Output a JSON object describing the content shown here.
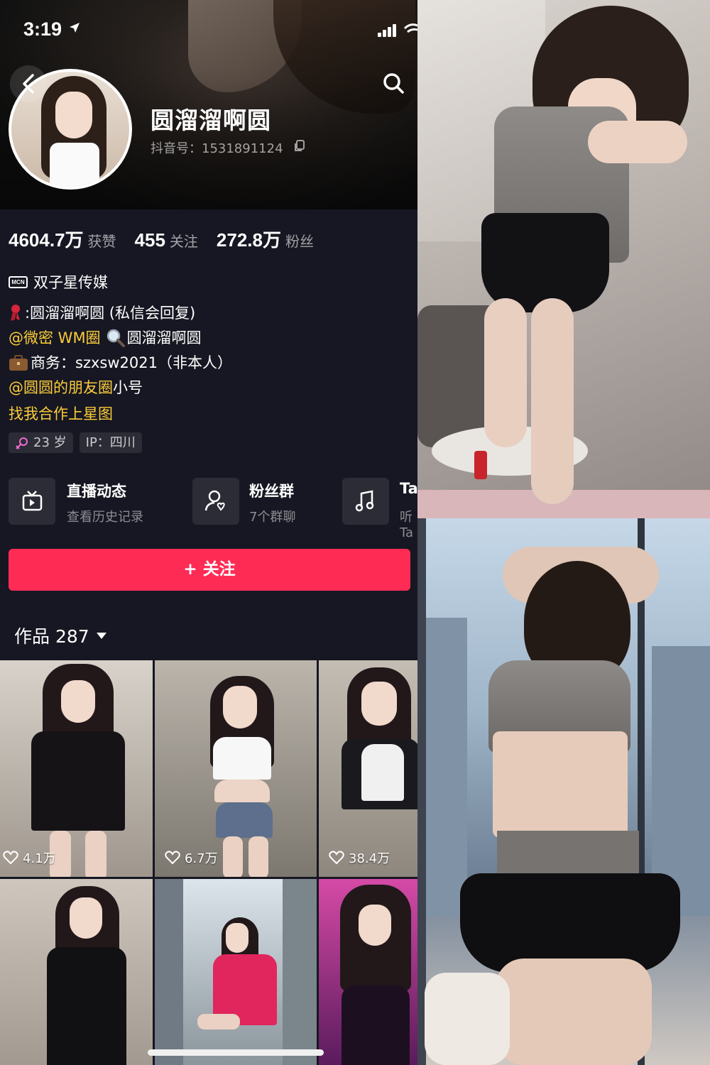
{
  "status_bar": {
    "time": "3:19"
  },
  "profile": {
    "nickname": "圆溜溜啊圆",
    "douyin_id": "抖音号：1531891124",
    "stats": [
      {
        "value": "4604.7万",
        "label": "获赞"
      },
      {
        "value": "455",
        "label": "关注"
      },
      {
        "value": "272.8万",
        "label": "粉丝"
      }
    ],
    "mcn": {
      "badge": "MCN",
      "name": "双子星传媒"
    },
    "bio": {
      "line1": ":圆溜溜啊圆 (私信会回复)",
      "line2_mention": "@微密 WM圈",
      "line2_text": "圆溜溜啊圆",
      "line3": "商务：szxsw2021（非本人）",
      "line4_mention": "@圆圆的朋友圈",
      "line4_text": " 小号",
      "line5": "找我合作上星图"
    },
    "tags": [
      "23 岁",
      "IP：四川"
    ]
  },
  "services": [
    {
      "title": "直播动态",
      "subtitle": "查看历史记录",
      "icon": "tv-play-icon"
    },
    {
      "title": "粉丝群",
      "subtitle": "7个群聊",
      "icon": "user-heart-icon"
    },
    {
      "title": "Ta",
      "subtitle": "听Ta",
      "icon": "music-note-icon"
    }
  ],
  "follow_button": {
    "label": "+ 关注"
  },
  "works": {
    "label": "作品 287",
    "tiles": [
      {
        "likes": "4.1万"
      },
      {
        "likes": "6.7万"
      },
      {
        "likes": "38.4万"
      },
      {
        "likes": ""
      },
      {
        "likes": ""
      },
      {
        "likes": ""
      }
    ]
  },
  "colors": {
    "background": "#161722",
    "follow": "#fe2c55",
    "mention": "#facc39",
    "chip": "#2b2c36"
  }
}
